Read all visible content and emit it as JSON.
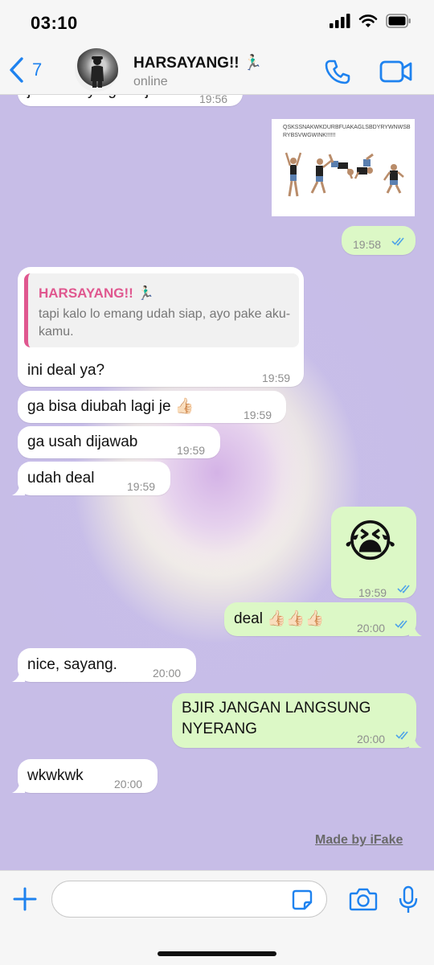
{
  "status_bar": {
    "time": "03:10"
  },
  "header": {
    "back_count": "7",
    "contact_name": "HARSAYANG!! 🏃🏻‍♂️",
    "contact_status": "online"
  },
  "messages": {
    "partial_top": {
      "text": "jawab kaya gitu aja",
      "time": "19:56"
    },
    "image_msg": {
      "caption": "QSKSSNAKWKDURBFUAKAGLSBDYRYWNWSBRYBSVWGWINK!!!!!!",
      "time": "19:58"
    },
    "reply_msg": {
      "quote_name": "HARSAYANG!! 🏃🏻‍♂️",
      "quote_text": "tapi kalo lo emang udah siap, ayo pake aku-kamu.",
      "text": "ini deal ya?",
      "time": "19:59"
    },
    "msg_ga_bisa": {
      "text": "ga bisa diubah lagi je 👍🏻",
      "time": "19:59"
    },
    "msg_ga_usah": {
      "text": "ga usah dijawab",
      "time": "19:59"
    },
    "msg_udah_deal": {
      "text": "udah deal",
      "time": "19:59"
    },
    "msg_emoji": {
      "text": "😭",
      "time": "19:59"
    },
    "msg_deal": {
      "text": "deal 👍🏻👍🏻👍🏻",
      "time": "20:00"
    },
    "msg_nice": {
      "text": "nice, sayang.",
      "time": "20:00"
    },
    "msg_bjir": {
      "line1": "BJIR JANGAN LANGSUNG",
      "line2": "NYERANG",
      "time": "20:00"
    },
    "msg_wkwk": {
      "text": "wkwkwk",
      "time": "20:00"
    }
  },
  "watermark": "Made by iFake",
  "input": {
    "value": "",
    "placeholder": ""
  },
  "colors": {
    "accent": "#1e82ef",
    "outgoing_bubble": "#dcf8c6",
    "incoming_bubble": "#ffffff",
    "quote_name": "#e0578f",
    "read_ticks": "#4fa3e8",
    "chat_background": "#c7bde7"
  },
  "icons": [
    "signal-icon",
    "wifi-icon",
    "battery-icon",
    "back-chevron-icon",
    "phone-icon",
    "video-camera-icon",
    "plus-icon",
    "sticker-icon",
    "camera-icon",
    "microphone-icon",
    "double-check-icon"
  ]
}
